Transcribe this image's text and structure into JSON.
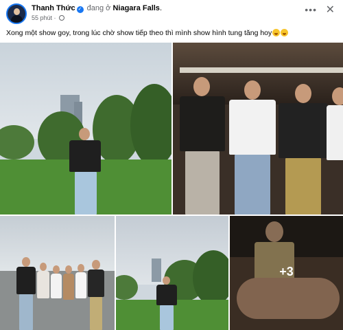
{
  "post": {
    "author": "Thanh Thức",
    "status_prefix": "đang ở",
    "location": "Niagara Falls",
    "location_suffix": ".",
    "time": "55 phút",
    "time_sep": "·",
    "caption": "Xong một show goy, trong lúc chờ show tiếp theo thì mình show hình tung tăng hoy",
    "caption_emojis": [
      "grinning-sweat-emoji",
      "grinning-sweat-emoji"
    ]
  },
  "header": {
    "more_label": "•••",
    "close_label": "✕",
    "verified_glyph": "✓"
  },
  "photos": [
    {
      "name": "photo-park-man-standing",
      "alt": "man in black sweater standing on park lawn near tower"
    },
    {
      "name": "photo-group-wine-bar",
      "alt": "group of men holding wine glasses at a bar"
    },
    {
      "name": "photo-group-riverside",
      "alt": "group of friends posing by the river"
    },
    {
      "name": "photo-man-on-lawn",
      "alt": "man standing on lawn with tower behind"
    },
    {
      "name": "photo-wine-toast",
      "alt": "people toasting with wine glasses"
    }
  ],
  "more_photos_label": "+3",
  "colors": {
    "brand_blue": "#1877f2",
    "muted_text": "#65676b"
  }
}
